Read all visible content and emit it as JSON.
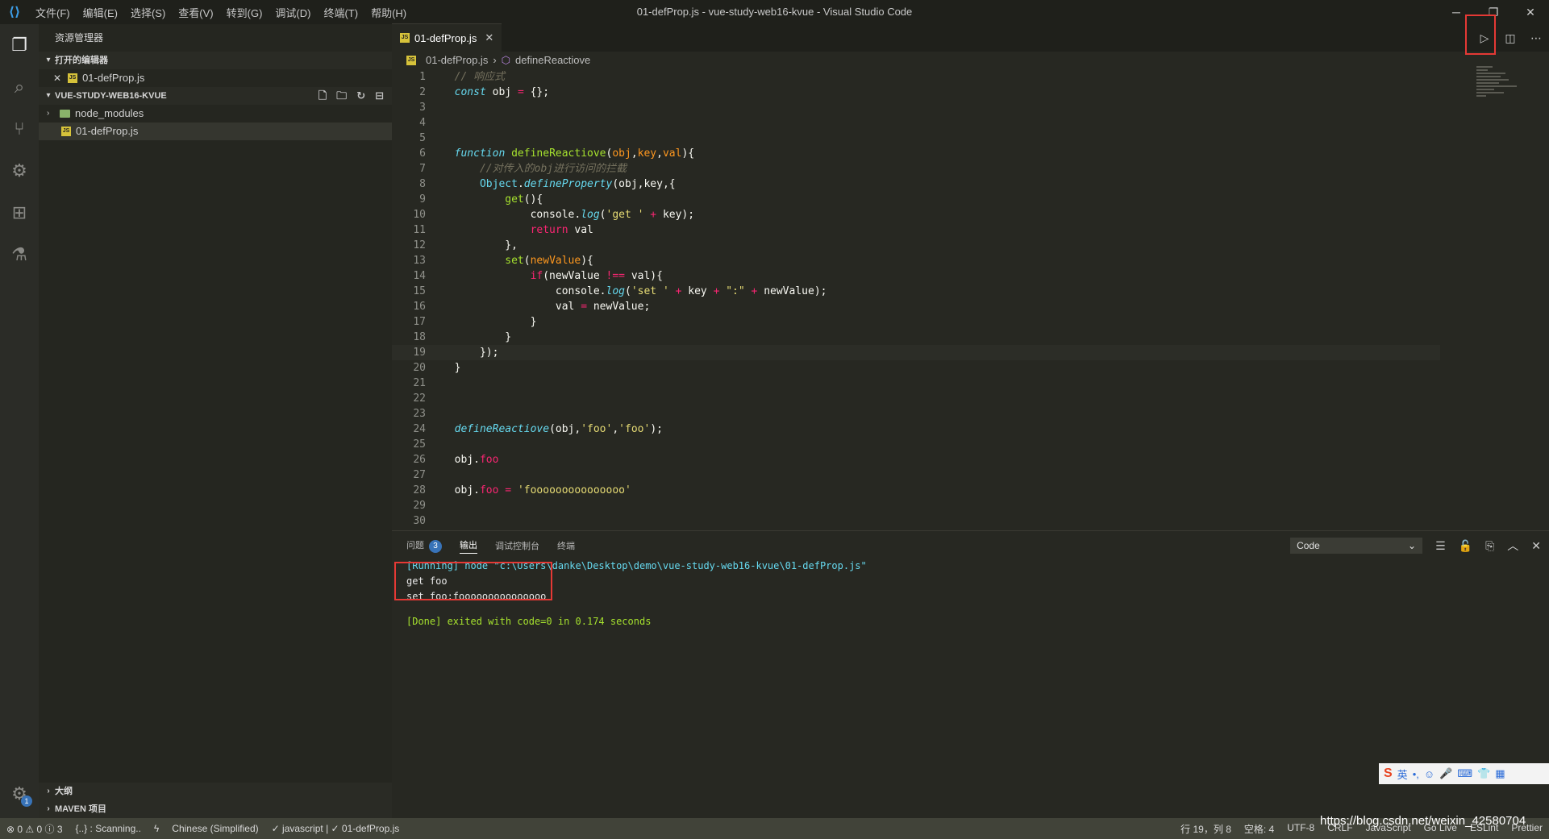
{
  "window": {
    "title": "01-defProp.js - vue-study-web16-kvue - Visual Studio Code",
    "menu": [
      "文件(F)",
      "编辑(E)",
      "选择(S)",
      "查看(V)",
      "转到(G)",
      "调试(D)",
      "终端(T)",
      "帮助(H)"
    ]
  },
  "sidebar": {
    "title": "资源管理器",
    "open_editors_label": "打开的编辑器",
    "open_editor_file": "01-defProp.js",
    "project_label": "VUE-STUDY-WEB16-KVUE",
    "tree": [
      "node_modules",
      "01-defProp.js"
    ],
    "outline_label": "大纲",
    "maven_label": "MAVEN 项目"
  },
  "editor": {
    "tab_label": "01-defProp.js",
    "breadcrumb_file": "01-defProp.js",
    "breadcrumb_symbol": "defineReactiove",
    "line_numbers": [
      "1",
      "2",
      "3",
      "4",
      "5",
      "6",
      "7",
      "8",
      "9",
      "10",
      "11",
      "12",
      "13",
      "14",
      "15",
      "16",
      "17",
      "18",
      "19",
      "20",
      "21",
      "22",
      "23",
      "24",
      "25",
      "26",
      "27",
      "28",
      "29",
      "30"
    ]
  },
  "panel": {
    "tabs": [
      "问题",
      "输出",
      "调试控制台",
      "终端"
    ],
    "problems_count": "3",
    "channel": "Code",
    "output_lines": [
      "[Running] node \"c:\\Users\\danke\\Desktop\\demo\\vue-study-web16-kvue\\01-defProp.js\"",
      "get foo",
      "set foo:fooooooooooooooo",
      "",
      "[Done] exited with code=0 in 0.174 seconds"
    ]
  },
  "statusbar": {
    "problems": "⊗ 0 ⚠ 0 ⓘ 3",
    "scanning": "{..} : Scanning..",
    "language_pack": "Chinese (Simplified)",
    "checks": "✓ javascript | ✓ 01-defProp.js",
    "position": "行 19，列 8",
    "spaces": "空格: 4",
    "encoding": "UTF-8",
    "eol": "CRLF",
    "lang": "JavaScript",
    "golive": "Go Live",
    "eslint": "ESLint",
    "prettier": "Prettier"
  },
  "watermark": "https://blog.csdn.net/weixin_42580704",
  "ime": {
    "label": "英"
  },
  "colors": {
    "accent_red": "#e53935",
    "badge_blue": "#3873b8",
    "js_icon": "#d6c23a"
  }
}
